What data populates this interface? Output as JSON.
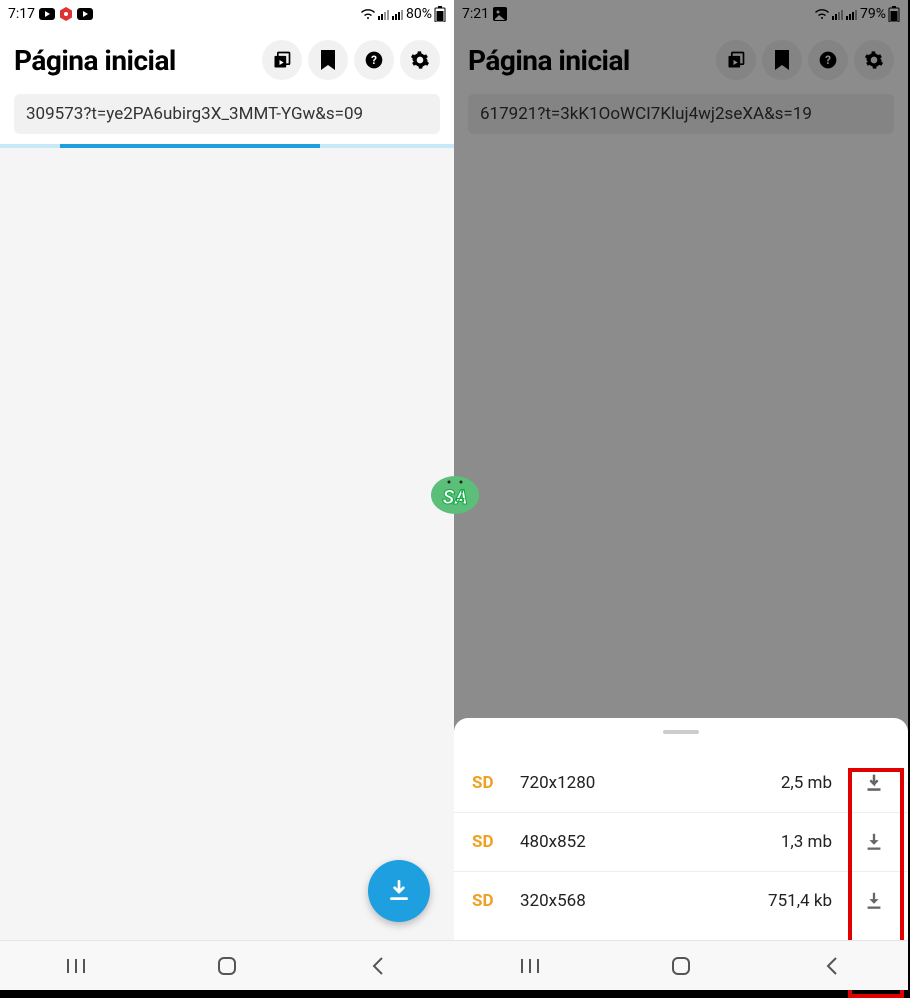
{
  "logo": {
    "text": "SA"
  },
  "left": {
    "status": {
      "time": "7:17",
      "battery": "80%"
    },
    "header": {
      "title": "Página inicial"
    },
    "url": "309573?t=ye2PA6ubirg3X_3MMT-YGw&s=09"
  },
  "right": {
    "status": {
      "time": "7:21",
      "battery": "79%"
    },
    "header": {
      "title": "Página inicial"
    },
    "url": "617921?t=3kK1OoWCI7Kluj4wj2seXA&s=19",
    "downloads": [
      {
        "quality": "SD",
        "resolution": "720x1280",
        "size": "2,5 mb"
      },
      {
        "quality": "SD",
        "resolution": "480x852",
        "size": "1,3 mb"
      },
      {
        "quality": "SD",
        "resolution": "320x568",
        "size": "751,4 kb"
      }
    ]
  }
}
